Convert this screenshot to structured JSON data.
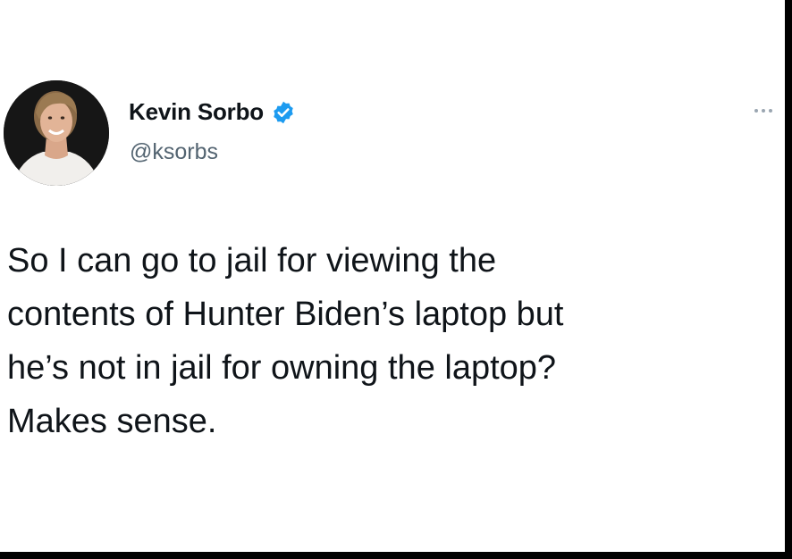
{
  "tweet": {
    "author": {
      "display_name": "Kevin Sorbo",
      "handle": "@ksorbs",
      "verified": true,
      "verified_color": "#1d9bf0"
    },
    "text_lines": [
      "So I can go to jail for viewing the",
      "contents of Hunter Biden’s laptop but",
      "he’s not in jail for owning the laptop?",
      "Makes sense."
    ],
    "more_icon": "more-horizontal-icon"
  }
}
